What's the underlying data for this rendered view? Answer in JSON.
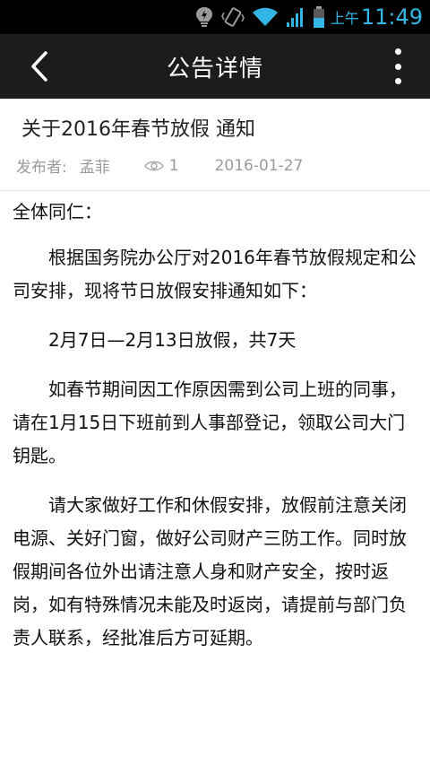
{
  "status_bar": {
    "ampm": "上午",
    "time": "11:49",
    "icons": [
      "bulb-icon",
      "vibrate-icon",
      "wifi-icon",
      "signal-icon",
      "battery-icon"
    ],
    "color": "#33b5e5"
  },
  "title_bar": {
    "title": "公告详情",
    "background": "#1e1c1b"
  },
  "notice": {
    "title": "关于2016年春节放假 通知",
    "publisher_label": "发布者:",
    "publisher": "孟菲",
    "views": "1",
    "date": "2016-01-27"
  },
  "body": {
    "greeting": "全体同仁：",
    "paragraphs": [
      "根据国务院办公厅对2016年春节放假规定和公司安排，现将节日放假安排通知如下：",
      "2月7日—2月13日放假，共7天",
      "如春节期间因工作原因需到公司上班的同事，请在1月15日下班前到人事部登记，领取公司大门钥匙。",
      "请大家做好工作和休假安排，放假前注意关闭电源、关好门窗，做好公司财产三防工作。同时放假期间各位外出请注意人身和财产安全，按时返岗，如有特殊情况未能及时返岗，请提前与部门负责人联系，经批准后方可延期。"
    ]
  }
}
